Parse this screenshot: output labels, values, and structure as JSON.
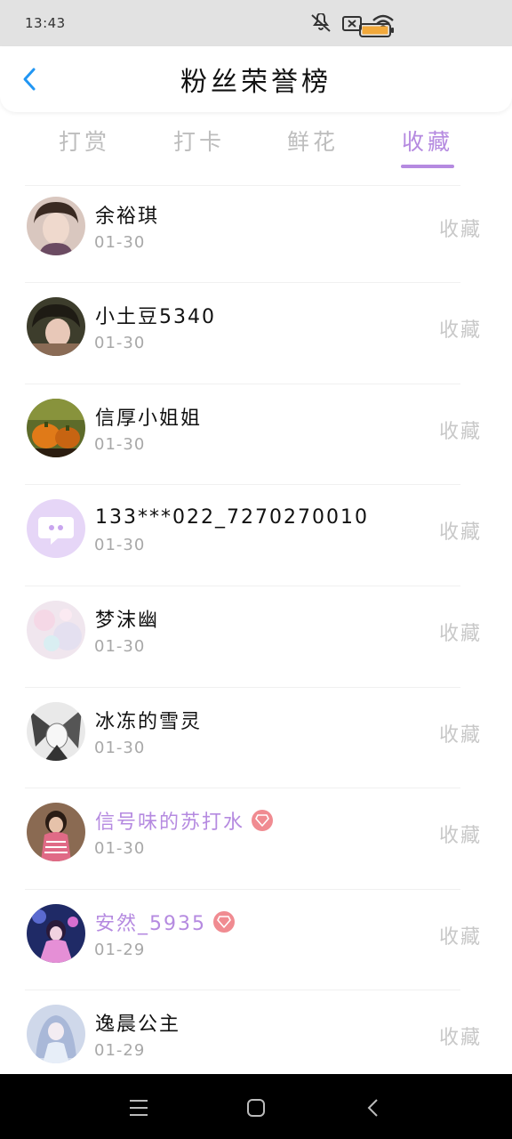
{
  "status_bar": {
    "time": "13:43",
    "icons": [
      "mute-icon",
      "no-sim-icon",
      "wifi-icon",
      "battery-icon"
    ]
  },
  "header": {
    "back_icon": "chevron-left-icon",
    "title": "粉丝荣誉榜"
  },
  "tabs": [
    {
      "label": "打赏",
      "active": false
    },
    {
      "label": "打卡",
      "active": false
    },
    {
      "label": "鲜花",
      "active": false
    },
    {
      "label": "收藏",
      "active": true
    }
  ],
  "colors": {
    "accent": "#b58ae0",
    "back_icon": "#2196f3",
    "vip_badge": "#f08b91",
    "inactive_text": "#bdbdbd",
    "date_text": "#a8a8a8"
  },
  "fans": [
    {
      "name": "余裕琪",
      "date": "01-30",
      "action": "收藏",
      "vip": false
    },
    {
      "name": "小土豆5340",
      "date": "01-30",
      "action": "收藏",
      "vip": false
    },
    {
      "name": "信厚小姐姐",
      "date": "01-30",
      "action": "收藏",
      "vip": false
    },
    {
      "name": "133***022_7270270010",
      "date": "01-30",
      "action": "收藏",
      "vip": false
    },
    {
      "name": "梦沫幽",
      "date": "01-30",
      "action": "收藏",
      "vip": false
    },
    {
      "name": "冰冻的雪灵",
      "date": "01-30",
      "action": "收藏",
      "vip": false
    },
    {
      "name": "信号味的苏打水",
      "date": "01-30",
      "action": "收藏",
      "vip": true
    },
    {
      "name": "安然_5935",
      "date": "01-29",
      "action": "收藏",
      "vip": true
    },
    {
      "name": "逸晨公主",
      "date": "01-29",
      "action": "收藏",
      "vip": false
    }
  ],
  "nav_bar": {
    "icons": [
      "menu-icon",
      "home-icon",
      "back-icon"
    ]
  }
}
